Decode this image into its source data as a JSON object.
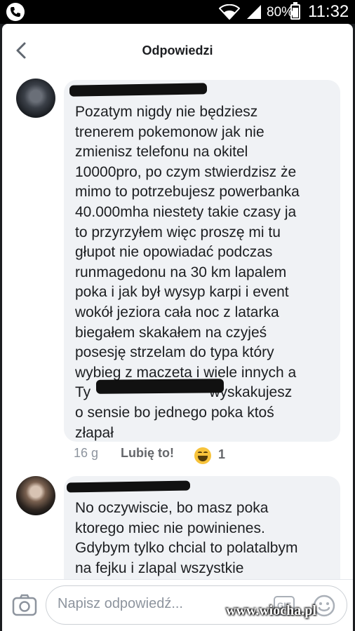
{
  "status_bar": {
    "battery": "80%",
    "time": "11:32"
  },
  "header": {
    "title": "Odpowiedzi",
    "back_icon": "chevron-left-icon"
  },
  "comments": [
    {
      "text_lines": [
        "Pozatym nigdy nie będziesz",
        "trenerem pokemonow jak nie",
        "zmienisz telefonu na okitel",
        "10000pro, po czym stwierdzisz że",
        "mimo to potrzebujesz powerbanka",
        "40.000mha niestety takie czasy ja",
        "to przyrzyłem więc proszę mi tu",
        "głupot nie opowiadać podczas",
        "runmagedonu na 30 km lapalem",
        "poka i jak był wysyp karpi i event",
        "wokół jeziora cała noc z latarka",
        "biegałem skakałem na czyjeś",
        "posesję strzelam do typa który",
        "wybieg z maczeta i wiele innych a",
        "Ty                             wyskakujesz",
        "o sensie bo jednego poka ktoś",
        "złapał"
      ],
      "time": "16 g",
      "like_label": "Lubię to!",
      "reaction_icon": "haha-emoji-icon",
      "reaction_count": "1"
    },
    {
      "text_lines": [
        "No oczywiscie, bo masz poka",
        "ktorego miec nie powinienes.",
        "Gdybym tylko chcial to polatalbym",
        "na fejku i zlapal wszystkie"
      ]
    }
  ],
  "composer": {
    "placeholder": "Napisz odpowiedź...",
    "gif_label": "GIF",
    "camera_icon": "camera-icon",
    "emoji_icon": "emoji-icon"
  },
  "watermark": "www.wiocha.pl",
  "colors": {
    "bubble": "#f0f2f5",
    "text": "#1c1e21",
    "muted": "#8d949e"
  }
}
